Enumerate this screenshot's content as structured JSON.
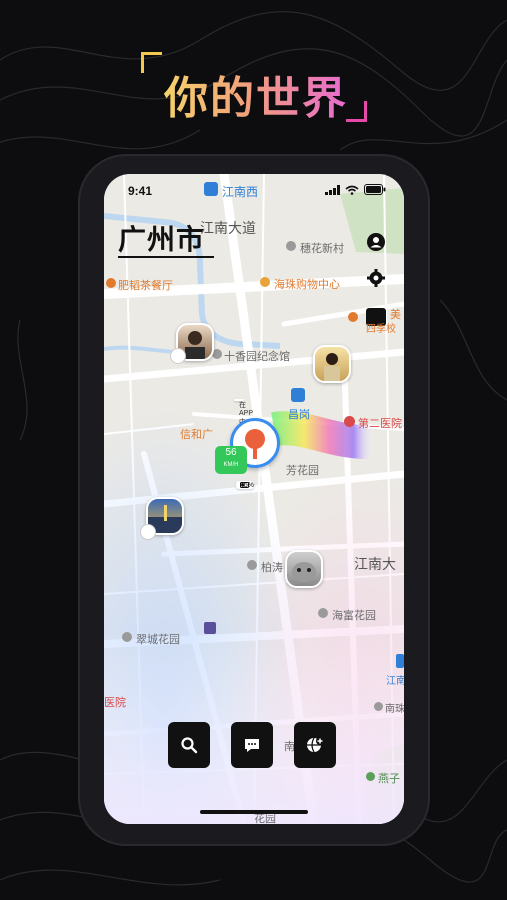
{
  "hero": {
    "title": "你的世界"
  },
  "status_bar": {
    "time": "9:41"
  },
  "map": {
    "city": "广州市",
    "labels": {
      "jiangnanxi": "江南西",
      "jiangnan_dadao": "江南大道",
      "suihua": "穗花新村",
      "feifan": "肥韬茶餐厅",
      "haizhu_mall": "海珠购物中心",
      "mei": "美",
      "xiao": "四季校",
      "shixiang": "十香园纪念馆",
      "changgang": "昌岗",
      "hospital2": "第二医院",
      "xinhe": "信和广",
      "fanghuayuan": "芳花园",
      "jiangnan_da2": "江南大",
      "bai": "柏涛",
      "haifu": "海富花园",
      "cuicheng": "翠城花园",
      "hospital": "医院",
      "nan": "南",
      "nanbian": "南珠",
      "jiang": "江南",
      "yanzi": "燕子",
      "huayuan_bottom": "花园"
    },
    "self_marker": {
      "status": "在 APP 中",
      "speed": "56",
      "speed_unit": "KM/H",
      "battery": "45%"
    }
  },
  "colors": {
    "accent": "#3a8df0",
    "speed_green": "#34c759"
  },
  "icons": [
    "profile-icon",
    "settings-icon",
    "search-icon",
    "message-icon",
    "add-friend-icon"
  ]
}
